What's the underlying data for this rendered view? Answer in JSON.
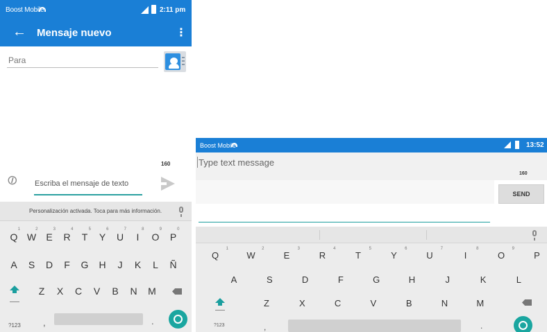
{
  "phone1": {
    "status": {
      "carrier": "Boost Mobile",
      "time": "2:11 pm"
    },
    "app_bar": {
      "back": "←",
      "title": "Mensaje nuevo",
      "more": "⋮"
    },
    "to_field": {
      "placeholder": "Para"
    },
    "char_count": "160",
    "message_field": {
      "placeholder": "Escriba el mensaje de texto"
    },
    "keyboard": {
      "suggestion_text": "Personalización activada. Toca para más información.",
      "row1": [
        {
          "key": "Q",
          "hint": "1"
        },
        {
          "key": "W",
          "hint": "2"
        },
        {
          "key": "E",
          "hint": "3"
        },
        {
          "key": "R",
          "hint": "4"
        },
        {
          "key": "T",
          "hint": "5"
        },
        {
          "key": "Y",
          "hint": "6"
        },
        {
          "key": "U",
          "hint": "7"
        },
        {
          "key": "I",
          "hint": "8"
        },
        {
          "key": "O",
          "hint": "9"
        },
        {
          "key": "P",
          "hint": "0"
        }
      ],
      "row2": [
        "A",
        "S",
        "D",
        "F",
        "G",
        "H",
        "J",
        "K",
        "L",
        "Ñ"
      ],
      "row3": [
        "Z",
        "X",
        "C",
        "V",
        "B",
        "N",
        "M"
      ],
      "symbols": "?123",
      "comma": ",",
      "period": "."
    }
  },
  "phone2": {
    "status": {
      "carrier": "Boost Mobile",
      "time": "13:52"
    },
    "message_field": {
      "placeholder": "Type text message"
    },
    "char_count": "160",
    "send_button": "SEND",
    "keyboard": {
      "row1": [
        {
          "key": "Q",
          "hint": "1"
        },
        {
          "key": "W",
          "hint": "2"
        },
        {
          "key": "E",
          "hint": "3"
        },
        {
          "key": "R",
          "hint": "4"
        },
        {
          "key": "T",
          "hint": "5"
        },
        {
          "key": "Y",
          "hint": "6"
        },
        {
          "key": "U",
          "hint": "7"
        },
        {
          "key": "I",
          "hint": "8"
        },
        {
          "key": "O",
          "hint": "9"
        },
        {
          "key": "P",
          "hint": "0"
        }
      ],
      "row2": [
        "A",
        "S",
        "D",
        "F",
        "G",
        "H",
        "J",
        "K",
        "L"
      ],
      "row3": [
        "Z",
        "X",
        "C",
        "V",
        "B",
        "N",
        "M"
      ],
      "symbols": "?123",
      "comma": ",",
      "period": "."
    }
  },
  "colors": {
    "primary": "#1a7fd6",
    "accent": "#1aa6a0",
    "keyboard_bg": "#ececec"
  }
}
